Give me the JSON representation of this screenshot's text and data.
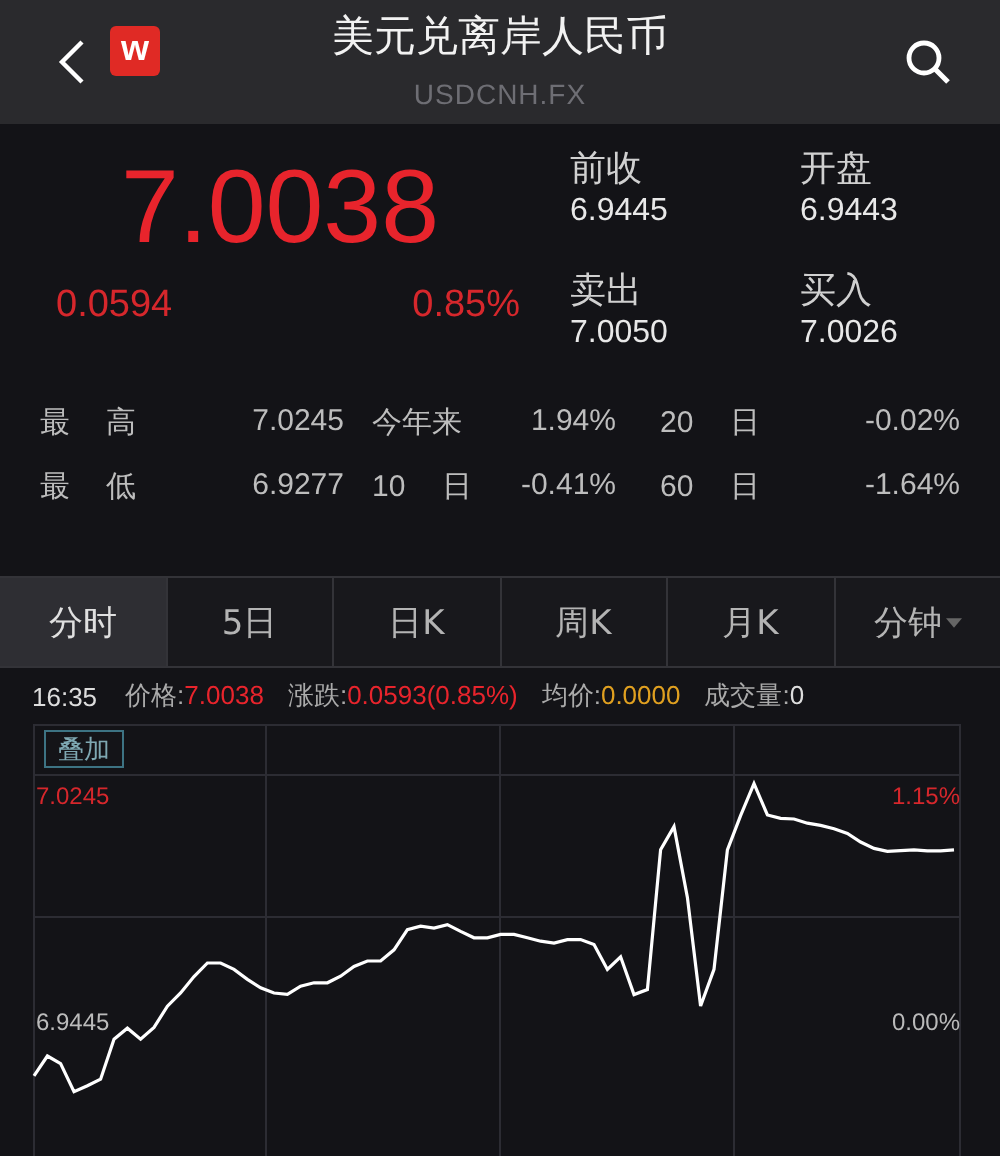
{
  "header": {
    "logo": "w",
    "title": "美元兑离岸人民币",
    "subtitle": "USDCNH.FX"
  },
  "quote": {
    "price": "7.0038",
    "change": "0.0594",
    "percent": "0.85%",
    "fields": [
      {
        "label": "前收",
        "value": "6.9445"
      },
      {
        "label": "开盘",
        "value": "6.9443"
      },
      {
        "label": "卖出",
        "value": "7.0050"
      },
      {
        "label": "买入",
        "value": "7.0026"
      }
    ]
  },
  "stats": [
    [
      "最 高",
      "7.0245",
      "今年来",
      "1.94%",
      "20 日",
      "-0.02%"
    ],
    [
      "最 低",
      "6.9277",
      "10 日",
      "-0.41%",
      "60 日",
      "-1.64%"
    ]
  ],
  "tabs": [
    {
      "label": "分时",
      "selected": true,
      "dropdown": false
    },
    {
      "label": "5日",
      "selected": false,
      "dropdown": false
    },
    {
      "label": "日K",
      "selected": false,
      "dropdown": false
    },
    {
      "label": "周K",
      "selected": false,
      "dropdown": false
    },
    {
      "label": "月K",
      "selected": false,
      "dropdown": false
    },
    {
      "label": "分钟",
      "selected": false,
      "dropdown": true
    }
  ],
  "info": {
    "time": "16:35",
    "items": [
      {
        "label": "价格:",
        "value": "7.0038",
        "color": "#e8242c"
      },
      {
        "label": "涨跌:",
        "value": "0.0593(0.85%)",
        "color": "#e8242c"
      },
      {
        "label": "均价:",
        "value": "0.0000",
        "color": "#e0a020"
      },
      {
        "label": "成交量:",
        "value": "0",
        "color": "#dddddd"
      }
    ]
  },
  "overlay_button": "叠加",
  "chart": {
    "right_labels": [
      "1.15%",
      "0.00%"
    ],
    "chart_data": {
      "type": "line",
      "ylim": [
        6.8914,
        7.0514
      ],
      "yticks": [
        {
          "value": 7.0245,
          "label": "7.0245"
        },
        {
          "value": 6.9445,
          "label": "6.9445"
        }
      ],
      "categories": [
        null,
        null,
        null,
        null,
        null,
        null,
        null,
        null,
        null,
        null,
        null,
        null,
        null,
        null,
        null,
        null,
        null,
        null,
        null,
        null,
        null,
        null,
        null,
        null,
        null,
        null,
        null,
        null,
        null,
        null,
        null,
        null,
        null,
        null,
        null,
        null,
        null,
        null,
        null,
        null,
        null,
        null,
        null,
        null,
        null,
        null,
        null,
        null,
        null,
        null,
        null,
        null,
        null,
        null,
        null,
        null,
        null,
        null,
        null,
        null,
        null,
        null,
        null,
        null,
        null,
        null,
        null,
        null,
        null,
        null
      ],
      "series": [
        {
          "color": "#ffffff",
          "values": [
            6.9269,
            6.9339,
            6.9312,
            6.9213,
            6.9233,
            6.9257,
            6.9398,
            6.9437,
            6.9398,
            6.944,
            6.9515,
            6.9562,
            6.962,
            6.9668,
            6.9668,
            6.9645,
            6.961,
            6.958,
            6.9562,
            6.9557,
            6.9586,
            6.9598,
            6.9598,
            6.9621,
            6.9656,
            6.9675,
            6.9675,
            6.9715,
            6.9786,
            6.9798,
            6.9792,
            6.9804,
            6.978,
            6.9757,
            6.9757,
            6.9769,
            6.9769,
            6.9757,
            6.9745,
            6.9739,
            6.9751,
            6.9751,
            6.9733,
            6.9645,
            6.969,
            6.9556,
            6.9574,
            7.0069,
            7.0151,
            6.99,
            6.9516,
            6.9645,
            7.0069,
            7.019,
            7.0303,
            7.0192,
            7.018,
            7.0178,
            7.0163,
            7.0155,
            7.0143,
            7.0127,
            7.0096,
            7.0074,
            7.0063,
            7.0066,
            7.0069,
            7.0065,
            7.0065,
            7.0069
          ]
        }
      ]
    }
  }
}
